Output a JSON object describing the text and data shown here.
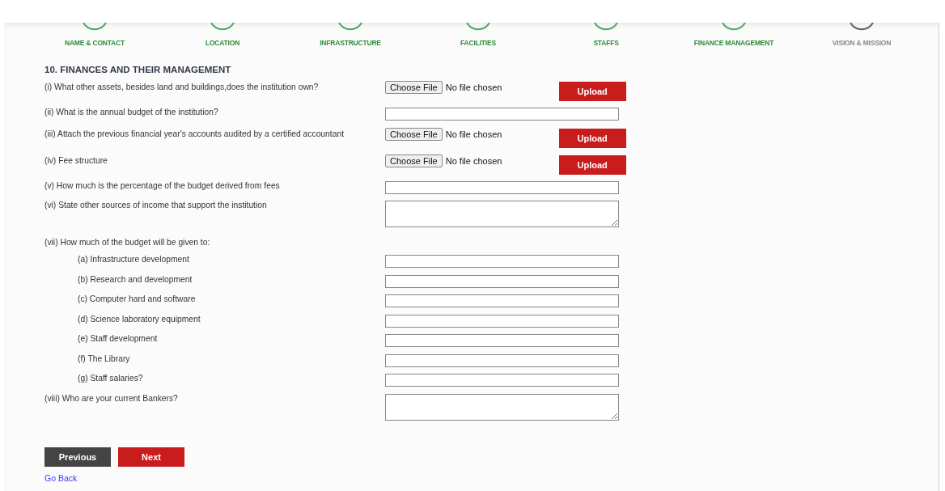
{
  "steps": [
    {
      "label": "NAME & CONTACT",
      "done": true
    },
    {
      "label": "LOCATION",
      "done": true
    },
    {
      "label": "INFRASTRUCTURE",
      "done": true
    },
    {
      "label": "FACILITIES",
      "done": true
    },
    {
      "label": "STAFFS",
      "done": true
    },
    {
      "label": "FINANCE MANAGEMENT",
      "done": true
    },
    {
      "label": "VISION & MISSION",
      "done": false
    }
  ],
  "section_title": "10. FINANCES AND THEIR MANAGEMENT",
  "questions": [
    {
      "kind": "file",
      "label": "(i) What other assets, besides land and buildings,does the institution own?",
      "choose_button": "Choose File",
      "file_status": "No file chosen",
      "upload_button": "Upload"
    },
    {
      "kind": "text",
      "label": "(ii) What is the annual budget of the institution?"
    },
    {
      "kind": "file",
      "label": "(iii) Attach the previous financial year's accounts audited by a certified accountant",
      "choose_button": "Choose File",
      "file_status": "No file chosen",
      "upload_button": "Upload"
    },
    {
      "kind": "file",
      "label": "(iv) Fee structure",
      "choose_button": "Choose File",
      "file_status": "No file chosen",
      "upload_button": "Upload"
    },
    {
      "kind": "text",
      "label": "(v) How much is the percentage of the budget derived from fees"
    },
    {
      "kind": "textarea",
      "label": "(vi) State other sources of income that support the institution"
    },
    {
      "kind": "heading",
      "label": "(vii) How much of the budget will be given to:"
    },
    {
      "kind": "subtext",
      "label": "(a) Infrastructure development"
    },
    {
      "kind": "subtext",
      "label": "(b) Research and development"
    },
    {
      "kind": "subtext",
      "label": "(c) Computer hard and software"
    },
    {
      "kind": "subtext",
      "label": "(d) Science laboratory equipment"
    },
    {
      "kind": "subtext",
      "label": "(e) Staff development"
    },
    {
      "kind": "subtext",
      "label": "(f) The Library"
    },
    {
      "kind": "subtext",
      "label": "(g) Staff salaries?"
    },
    {
      "kind": "textarea",
      "label": "(viii) Who are your current Bankers?"
    }
  ],
  "buttons": {
    "previous": "Previous",
    "next": "Next"
  },
  "back_link": "Go Back"
}
